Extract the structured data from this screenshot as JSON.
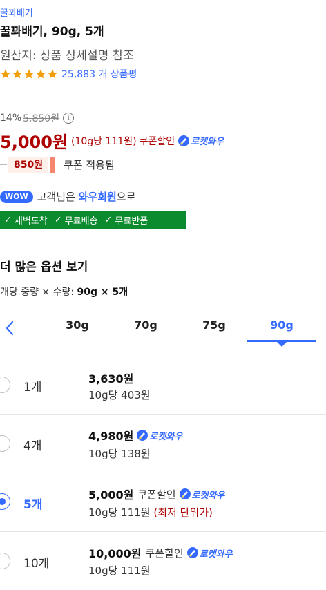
{
  "product": {
    "brand": "꿀꽈배기",
    "title": "꿀꽈배기, 90g, 5개",
    "origin": "원산지: 상품 상세설명 참조",
    "rating_stars": 5,
    "review_count": "25,883 개 상품평"
  },
  "pricing": {
    "discount_pct": "14%",
    "original_price": "5,850원",
    "info_symbol": "i",
    "sale_price": "5,000원",
    "unit_price": "(10g당 111원)",
    "coupon_label": "쿠폰할인",
    "rocket_label": "로켓와우",
    "coupon_amount": "850원",
    "coupon_applied": "쿠폰 적용됨"
  },
  "wow": {
    "pill": "WOW",
    "text_before": "고객님은 ",
    "member": "와우회원",
    "text_after": "으로"
  },
  "benefits": [
    "새벽도착",
    "무료배송",
    "무료반품"
  ],
  "options": {
    "title": "더 많은 옵션 보기",
    "summary_prefix": "개당 중량 × 수량: ",
    "summary_value": "90g × 5개",
    "tabs": [
      {
        "label": "30g",
        "active": false
      },
      {
        "label": "70g",
        "active": false
      },
      {
        "label": "75g",
        "active": false
      },
      {
        "label": "90g",
        "active": true
      }
    ],
    "rows": [
      {
        "qty": "1개",
        "price": "3,630원",
        "coupon": "",
        "rocket": false,
        "unit": "10g당 403원",
        "note": "",
        "selected": false
      },
      {
        "qty": "4개",
        "price": "4,980원",
        "coupon": "",
        "rocket": true,
        "unit": "10g당 138원",
        "note": "",
        "selected": false
      },
      {
        "qty": "5개",
        "price": "5,000원",
        "coupon": "쿠폰할인",
        "rocket": true,
        "unit": "10g당 111원",
        "note": "(최저 단위가)",
        "selected": true
      },
      {
        "qty": "10개",
        "price": "10,000원",
        "coupon": "쿠폰할인",
        "rocket": true,
        "unit": "10g당 111원",
        "note": "",
        "selected": false
      }
    ]
  },
  "colors": {
    "accent": "#346aff",
    "price_red": "#ae0000",
    "benefit_green": "#0c8a2e",
    "star": "#f29e0b"
  }
}
